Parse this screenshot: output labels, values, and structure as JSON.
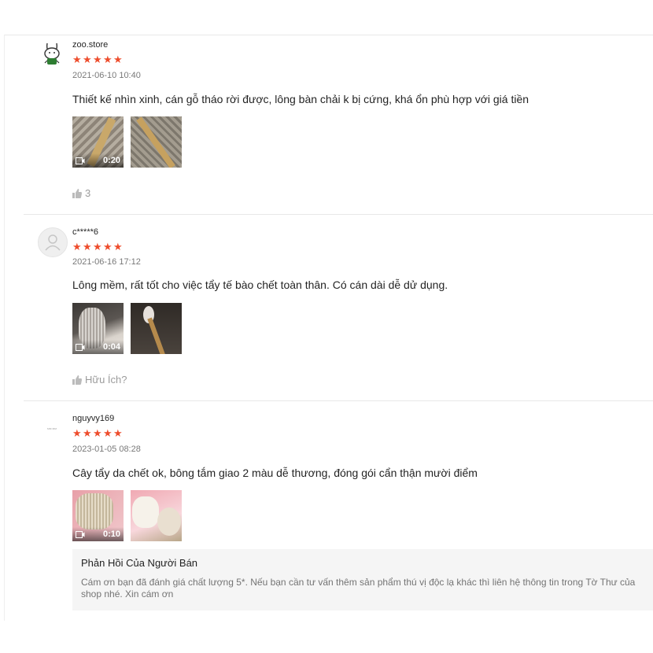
{
  "reviews": [
    {
      "username": "zoo.store",
      "rating": 5,
      "time": "2021-06-10 10:40",
      "comment": "Thiết kế nhìn xinh, cán gỗ tháo rời được, lông bàn chải k bị cứng, khá ổn phù hợp với giá tiền",
      "video_duration": "0:20",
      "helpful_text": "3",
      "avatar_icon": "rabbit-cartoon-icon"
    },
    {
      "username": "c*****6",
      "rating": 5,
      "time": "2021-06-16 17:12",
      "comment": "Lông mềm, rất tốt cho việc tẩy tế bào chết toàn thân. Có cán dài dễ dử dụng.",
      "video_duration": "0:04",
      "helpful_text": "Hữu Ích?",
      "avatar_icon": "default-user-icon"
    },
    {
      "username": "nguyvy169",
      "rating": 5,
      "time": "2023-01-05 08:28",
      "comment": "Cây tẩy da chết ok, bông tắm giao 2 màu dễ thương, đóng gói cẩn thận mười điểm",
      "video_duration": "0:10",
      "avatar_icon": "small-logo-icon",
      "avatar_logo_text": "ᴍᴍ ᴍᴍ"
    }
  ],
  "seller_reply": {
    "title": "Phản Hồi Của Người Bán",
    "text": "Cám ơn bạn đã đánh giá chất lượng 5*. Nếu bạn cần tư vấn thêm sản phẩm thú vị độc lạ khác thì liên hệ thông tin trong Tờ Thư của shop nhé. Xin cám ơn"
  },
  "colors": {
    "star": "#ee4d2d",
    "divider": "#e8e8e8",
    "reply_bg": "#f5f5f5"
  },
  "icons": {
    "star": "★",
    "thumb": "thumbs-up-icon",
    "video": "video-camera-icon"
  }
}
